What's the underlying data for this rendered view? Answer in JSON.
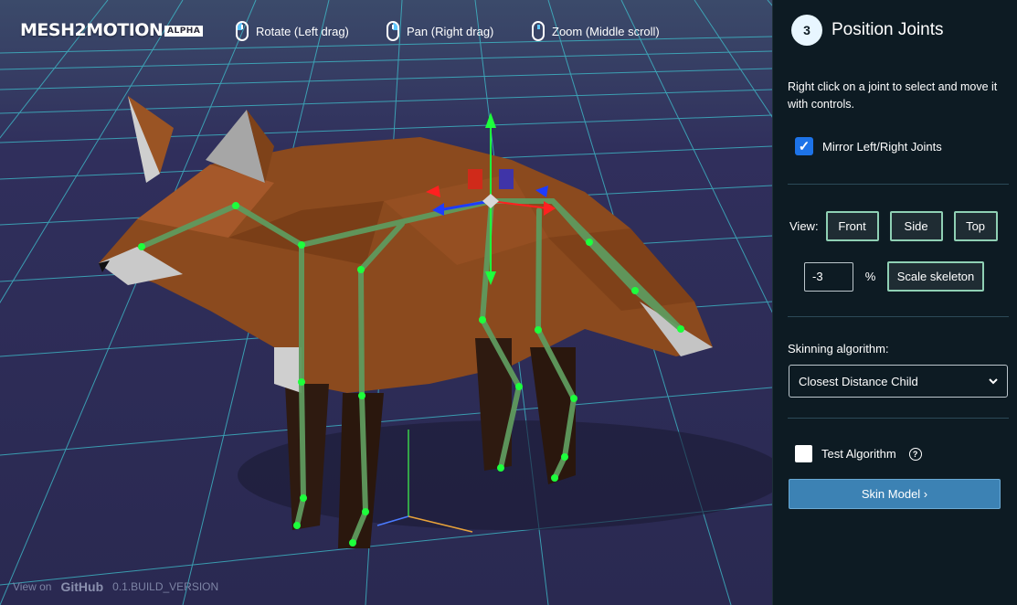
{
  "app": {
    "logo_text": "MESH2MOTION",
    "logo_badge": "ALPHA",
    "version": "0.1.BUILD_VERSION"
  },
  "hints": [
    {
      "icon": "mouse-left-icon",
      "label": "Rotate (Left drag)"
    },
    {
      "icon": "mouse-right-icon",
      "label": "Pan (Right drag)"
    },
    {
      "icon": "mouse-middle-icon",
      "label": "Zoom (Middle scroll)"
    }
  ],
  "footer": {
    "view_on": "View on",
    "github": "GitHub"
  },
  "panel": {
    "step_number": "3",
    "step_title": "Position Joints",
    "instructions": "Right click on a joint to select and move it with controls.",
    "mirror": {
      "label": "Mirror Left/Right Joints",
      "checked": true
    },
    "view": {
      "label": "View:",
      "buttons": [
        "Front",
        "Side",
        "Top"
      ]
    },
    "scale": {
      "value": "-3",
      "unit": "%",
      "button": "Scale skeleton"
    },
    "skinning": {
      "label": "Skinning algorithm:",
      "selected": "Closest Distance Child"
    },
    "test": {
      "label": "Test Algorithm",
      "checked": false
    },
    "skin_button": "Skin Model ›"
  },
  "colors": {
    "bone": "#5f9a5e",
    "joint": "#1dff3c",
    "grid": "#3fc2cf",
    "accent": "#3c82b4",
    "panel_bg": "#0d1b23",
    "scene_bg": "#2b2a52"
  }
}
